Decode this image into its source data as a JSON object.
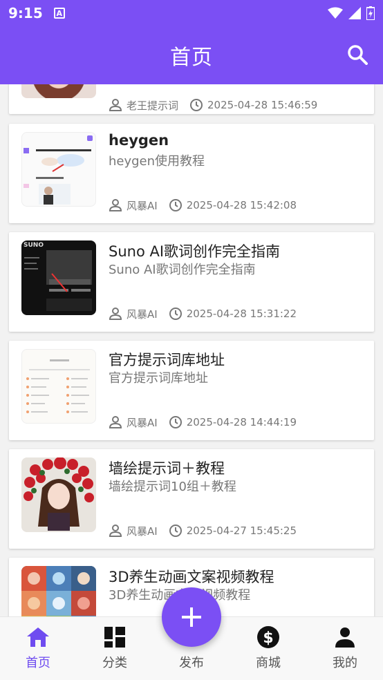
{
  "status_bar": {
    "time": "9:15",
    "a_label": "A"
  },
  "header": {
    "title": "首页"
  },
  "items": [
    {
      "title": "",
      "subtitle": "",
      "author": "老王提示词",
      "time": "2025-04-28 15:46:59",
      "thumb": "woman-portrait-photo"
    },
    {
      "title": "heygen",
      "subtitle": "heygen使用教程",
      "author": "风暴AI",
      "time": "2025-04-28 15:42:08",
      "thumb": "heygen-screenshot"
    },
    {
      "title": "Suno AI歌词创作完全指南",
      "subtitle": "Suno AI歌词创作完全指南",
      "author": "风暴AI",
      "time": "2025-04-28 15:31:22",
      "thumb": "suno-dark-screenshot",
      "thumb_text": "SUNO"
    },
    {
      "title": "官方提示词库地址",
      "subtitle": "官方提示词库地址",
      "author": "风暴AI",
      "time": "2025-04-28 14:44:19",
      "thumb": "prompt-library-screenshot"
    },
    {
      "title": "墙绘提示词＋教程",
      "subtitle": "墙绘提示词10组＋教程",
      "author": "风暴AI",
      "time": "2025-04-27 15:45:25",
      "thumb": "flower-girl-illustration"
    },
    {
      "title": "3D养生动画文案视频教程",
      "subtitle": "3D养生动画文案视频教程",
      "author": "",
      "time": "",
      "thumb": "3d-health-animation-collage"
    }
  ],
  "nav": [
    {
      "label": "首页",
      "icon": "home-icon",
      "active": true
    },
    {
      "label": "分类",
      "icon": "category-grid-icon",
      "active": false
    },
    {
      "label": "发布",
      "icon": "plus-icon",
      "active": false
    },
    {
      "label": "商城",
      "icon": "dollar-icon",
      "active": false
    },
    {
      "label": "我的",
      "icon": "person-icon",
      "active": false
    }
  ],
  "colors": {
    "primary": "#7b4ff4",
    "active_nav": "#6f4cf0",
    "text_secondary": "#777777"
  }
}
